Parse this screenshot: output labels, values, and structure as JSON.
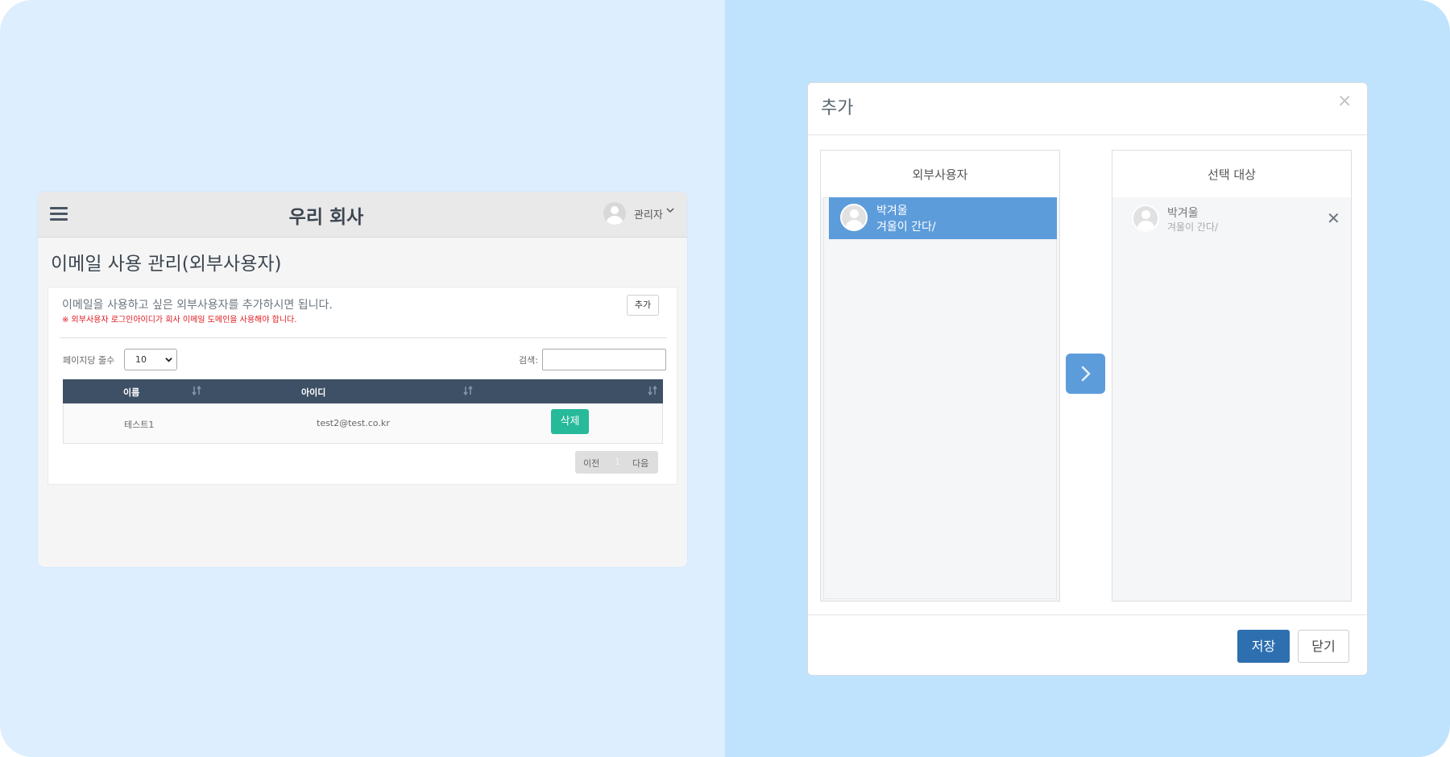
{
  "app": {
    "title": "우리 회사",
    "user_label": "관리자",
    "page_title": "이메일 사용 관리(외부사용자)"
  },
  "card": {
    "info": "이메일을 사용하고 싶은 외부사용자를 추가하시면 됩니다.",
    "warning": "※ 외부사용자 로그인아이디가 회사 이메일 도메인을 사용해야 합니다.",
    "add_label": "추가",
    "per_page_label": "페이지당 줄수",
    "per_page_value": "10",
    "search_label": "검색:",
    "search_value": ""
  },
  "table": {
    "columns": [
      "이름",
      "아이디",
      ""
    ],
    "rows": [
      {
        "name": "테스트1",
        "id": "test2@test.co.kr",
        "action": "삭제"
      }
    ]
  },
  "pager": {
    "prev": "이전",
    "current": "1",
    "next": "다음"
  },
  "modal": {
    "title": "추가",
    "close_glyph": "×",
    "left_pane_title": "외부사용자",
    "right_pane_title": "선택 대상",
    "left_items": [
      {
        "name": "박겨울",
        "status": "겨울이 간다/"
      }
    ],
    "right_items": [
      {
        "name": "박겨울",
        "status": "겨울이 간다/"
      }
    ],
    "remove_glyph": "✕",
    "save_label": "저장",
    "close_label": "닫기"
  },
  "colors": {
    "background_left": "#ddeefe",
    "background_right": "#bfe2fd",
    "table_header": "#3e5066",
    "delete_button": "#26b99a",
    "selected_item": "#5d9cdb",
    "save_button": "#2e6fb0",
    "warning_text": "#e0181e"
  },
  "icons": [
    "menu-icon",
    "user-avatar-icon",
    "chevron-down-icon",
    "sort-icon",
    "close-icon",
    "chevron-right-icon",
    "remove-icon"
  ]
}
